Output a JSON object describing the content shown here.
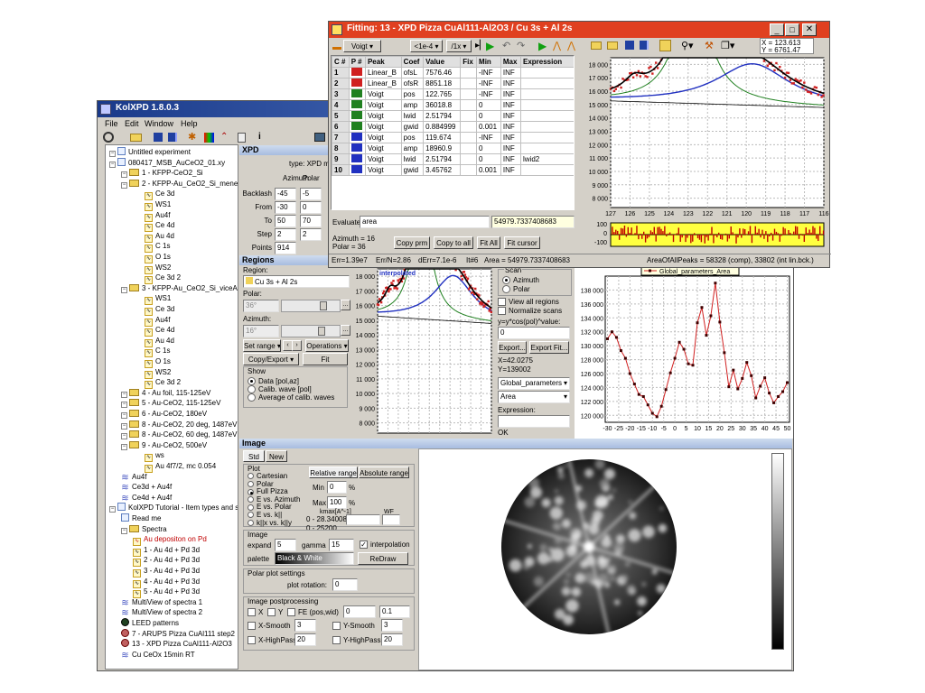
{
  "main_window": {
    "title": "KolXPD 1.8.0.3",
    "menu": [
      "File",
      "Edit",
      "Window",
      "Help"
    ],
    "tree": [
      {
        "label": "Untitled experiment",
        "depth": 0,
        "kind": "doc"
      },
      {
        "label": "080417_MSB_AuCeO2_01.xy",
        "depth": 0,
        "kind": "doc"
      },
      {
        "label": "1 - KFPP-CeO2_Si",
        "depth": 1,
        "kind": "folder"
      },
      {
        "label": "2 - KFPP-Au_CeO2_Si_meneAu",
        "depth": 1,
        "kind": "folder"
      },
      {
        "label": "Ce 3d",
        "depth": 3,
        "kind": "spec"
      },
      {
        "label": "WS1",
        "depth": 3,
        "kind": "spec"
      },
      {
        "label": "Au4f",
        "depth": 3,
        "kind": "spec"
      },
      {
        "label": "Ce 4d",
        "depth": 3,
        "kind": "spec"
      },
      {
        "label": "Au 4d",
        "depth": 3,
        "kind": "spec"
      },
      {
        "label": "C 1s",
        "depth": 3,
        "kind": "spec"
      },
      {
        "label": "O 1s",
        "depth": 3,
        "kind": "spec"
      },
      {
        "label": "WS2",
        "depth": 3,
        "kind": "spec"
      },
      {
        "label": "Ce 3d 2",
        "depth": 3,
        "kind": "spec"
      },
      {
        "label": "3 - KFPP-Au_CeO2_Si_viceAu",
        "depth": 1,
        "kind": "folder"
      },
      {
        "label": "WS1",
        "depth": 3,
        "kind": "spec"
      },
      {
        "label": "Ce 3d",
        "depth": 3,
        "kind": "spec"
      },
      {
        "label": "Au4f",
        "depth": 3,
        "kind": "spec"
      },
      {
        "label": "Ce 4d",
        "depth": 3,
        "kind": "spec"
      },
      {
        "label": "Au 4d",
        "depth": 3,
        "kind": "spec"
      },
      {
        "label": "C 1s",
        "depth": 3,
        "kind": "spec"
      },
      {
        "label": "O 1s",
        "depth": 3,
        "kind": "spec"
      },
      {
        "label": "WS2",
        "depth": 3,
        "kind": "spec"
      },
      {
        "label": "Ce 3d 2",
        "depth": 3,
        "kind": "spec"
      },
      {
        "label": "4 - Au foil, 115-125eV",
        "depth": 1,
        "kind": "folder"
      },
      {
        "label": "5 - Au-CeO2, 115-125eV",
        "depth": 1,
        "kind": "folder"
      },
      {
        "label": "6 - Au-CeO2, 180eV",
        "depth": 1,
        "kind": "folder"
      },
      {
        "label": "8 - Au-CeO2, 20 deg, 1487eV",
        "depth": 1,
        "kind": "folder"
      },
      {
        "label": "8 - Au-CeO2, 60 deg, 1487eV",
        "depth": 1,
        "kind": "folder"
      },
      {
        "label": "9 - Au-CeO2, 500eV",
        "depth": 1,
        "kind": "folder"
      },
      {
        "label": "ws",
        "depth": 3,
        "kind": "spec"
      },
      {
        "label": "Au 4f7/2, mc 0.054",
        "depth": 3,
        "kind": "spec"
      },
      {
        "label": "Au4f",
        "depth": 1,
        "kind": "multi"
      },
      {
        "label": "Ce3d + Au4f",
        "depth": 1,
        "kind": "multi"
      },
      {
        "label": "Ce4d + Au4f",
        "depth": 1,
        "kind": "multi"
      },
      {
        "label": "KolXPD Tutorial - Item types and sam",
        "depth": 0,
        "kind": "doc"
      },
      {
        "label": "Read me",
        "depth": 1,
        "kind": "doc"
      },
      {
        "label": "Spectra",
        "depth": 1,
        "kind": "folder"
      },
      {
        "label": "Au depositon on Pd",
        "depth": 2,
        "kind": "spec",
        "color": "#c00000"
      },
      {
        "label": "1 - Au 4d + Pd 3d",
        "depth": 2,
        "kind": "spec"
      },
      {
        "label": "2 - Au 4d + Pd 3d",
        "depth": 2,
        "kind": "spec"
      },
      {
        "label": "3 - Au 4d + Pd 3d",
        "depth": 2,
        "kind": "spec"
      },
      {
        "label": "4 - Au 4d + Pd 3d",
        "depth": 2,
        "kind": "spec"
      },
      {
        "label": "5 - Au 4d + Pd 3d",
        "depth": 2,
        "kind": "spec"
      },
      {
        "label": "MultiView of spectra 1",
        "depth": 1,
        "kind": "multi"
      },
      {
        "label": "MultiView of spectra 2",
        "depth": 1,
        "kind": "multi"
      },
      {
        "label": "LEED patterns",
        "depth": 1,
        "kind": "leed"
      },
      {
        "label": "7 - ARUPS Pizza CuAl111 step2",
        "depth": 1,
        "kind": "pizza"
      },
      {
        "label": "13 - XPD Pizza CuAl111-Al2O3",
        "depth": 1,
        "kind": "pizza"
      },
      {
        "label": "Cu CeOx 15min RT",
        "depth": 1,
        "kind": "multi"
      }
    ]
  },
  "xpd_panel": {
    "header": "XPD",
    "type_label": "type: XPD me",
    "col_azimuth": "Azimuth",
    "col_polar": "Polar",
    "rows": [
      {
        "label": "Backlash",
        "az": "-45",
        "pol": "-5"
      },
      {
        "label": "From",
        "az": "-30",
        "pol": "0"
      },
      {
        "label": "To",
        "az": "50",
        "pol": "70"
      },
      {
        "label": "Step",
        "az": "2",
        "pol": "2"
      },
      {
        "label": "Points",
        "az": "914",
        "pol": ""
      }
    ]
  },
  "regions_panel": {
    "header": "Regions",
    "region_label": "Region:",
    "region_value": "Cu 3s + Al 2s",
    "polar_label": "Polar:",
    "polar_value": "36°",
    "azimuth_label": "Azimuth:",
    "azimuth_value": "16°",
    "set_range": "Set range",
    "operations": "Operations",
    "copy_export": "Copy/Export",
    "fit": "Fit",
    "show_label": "Show",
    "show_options": [
      "Data [pol,az]",
      "Calib. wave [pol]",
      "Average of calib. waves"
    ],
    "plot_label": "interpolated",
    "scan_label": "Scan",
    "scan_options": [
      "Azimuth",
      "Polar"
    ],
    "view_all": "View all regions",
    "normalize": "Normalize scans",
    "formula_label": "y=y*cos(pol)^value:",
    "formula_value": "0",
    "export_btn": "Export...",
    "export_fit_btn": "Export Fit...",
    "x_readout": "X=42.0275",
    "y_readout": "Y=139002",
    "param_select": "Global_parameters",
    "area_select": "Area",
    "expression_label": "Expression:",
    "ok_label": "OK",
    "legend": "Global_parameters_Area"
  },
  "image_panel": {
    "header": "Image",
    "tabs": [
      "Std",
      "New"
    ],
    "plot_group": "Plot",
    "plot_options": [
      "Cartesian",
      "Polar",
      "Full Pizza",
      "E vs. Azimuth",
      "E vs. Polar",
      "E vs. k||",
      "k||x vs. k||y"
    ],
    "range_tabs": [
      "Relative range",
      "Absolute range"
    ],
    "min_label": "Min",
    "min_value": "0",
    "max_label": "Max",
    "max_value": "100",
    "pct": "%",
    "kmax_label": "kmax[A^-1]",
    "wf_label": "WF",
    "range1": "0 - 28.340081",
    "range2": "0 - 25200",
    "image_group": "Image",
    "expand_label": "expand",
    "expand_value": "5",
    "gamma_label": "gamma",
    "gamma_value": "15",
    "interp_label": "interpolation",
    "palette_label": "palette",
    "palette_value": "Black & White",
    "redraw": "ReDraw",
    "polar_settings": "Polar plot settings",
    "rotation_label": "plot rotation:",
    "rotation_value": "0",
    "postproc": "Image postprocessing",
    "x_lbl": "X",
    "y_lbl": "Y",
    "fe_lbl": "FE (pos,wid)",
    "fe_pos": "0",
    "fe_wid": "0.1",
    "xsmooth": "X-Smooth",
    "xsmooth_v": "3",
    "ysmooth": "Y-Smooth",
    "ysmooth_v": "3",
    "xhigh": "X-HighPass",
    "xhigh_v": "20",
    "yhigh": "Y-HighPass",
    "yhigh_v": "20"
  },
  "fit_window": {
    "title": "Fitting: 13 - XPD Pizza CuAl111-Al2O3 / Cu 3s + Al 2s",
    "profile": "Voigt",
    "tol": "<1e-4",
    "iter": "/1x",
    "coords": [
      "X = 123.613",
      "Y = 6761.47"
    ],
    "headers": [
      "C #",
      "P #",
      "Peak",
      "Coef",
      "Value",
      "Fix",
      "Min",
      "Max",
      "Expression"
    ],
    "rows": [
      {
        "c": "1",
        "color": "#d02020",
        "peak": "Linear_B",
        "coef": "ofsL",
        "value": "7576.46",
        "fix": "",
        "min": "-INF",
        "max": "INF",
        "expr": ""
      },
      {
        "c": "2",
        "color": "#d02020",
        "peak": "Linear_B",
        "coef": "ofsR",
        "value": "8851.18",
        "fix": "",
        "min": "-INF",
        "max": "INF",
        "expr": ""
      },
      {
        "c": "3",
        "color": "#208020",
        "peak": "Voigt",
        "coef": "pos",
        "value": "122.765",
        "fix": "",
        "min": "-INF",
        "max": "INF",
        "expr": ""
      },
      {
        "c": "4",
        "color": "#208020",
        "peak": "Voigt",
        "coef": "amp",
        "value": "36018.8",
        "fix": "",
        "min": "0",
        "max": "INF",
        "expr": ""
      },
      {
        "c": "5",
        "color": "#208020",
        "peak": "Voigt",
        "coef": "lwid",
        "value": "2.51794",
        "fix": "",
        "min": "0",
        "max": "INF",
        "expr": ""
      },
      {
        "c": "6",
        "color": "#208020",
        "peak": "Voigt",
        "coef": "gwid",
        "value": "0.884999",
        "fix": "",
        "min": "0.001",
        "max": "INF",
        "expr": ""
      },
      {
        "c": "7",
        "color": "#2030c0",
        "peak": "Voigt",
        "coef": "pos",
        "value": "119.674",
        "fix": "",
        "min": "-INF",
        "max": "INF",
        "expr": ""
      },
      {
        "c": "8",
        "color": "#2030c0",
        "peak": "Voigt",
        "coef": "amp",
        "value": "18960.9",
        "fix": "",
        "min": "0",
        "max": "INF",
        "expr": ""
      },
      {
        "c": "9",
        "color": "#2030c0",
        "peak": "Voigt",
        "coef": "lwid",
        "value": "2.51794",
        "fix": "",
        "min": "0",
        "max": "INF",
        "expr": "lwid2"
      },
      {
        "c": "10",
        "color": "#2030c0",
        "peak": "Voigt",
        "coef": "gwid",
        "value": "3.45762",
        "fix": "",
        "min": "0.001",
        "max": "INF",
        "expr": ""
      }
    ],
    "evaluate_label": "Evaluate:",
    "evaluate_value": "area",
    "evaluate_result": "54979.7337408683",
    "az_info": "Azimuth = 16",
    "pol_info": "Polar = 36",
    "copy_prm": "Copy prm",
    "copy_all": "Copy to all",
    "fit_all": "Fit All",
    "fit_cursor": "Fit cursor",
    "status": [
      "Err=1.39e7",
      "Err/N=2.86",
      "dErr=7.1e-6",
      "It#6",
      "Area = 54979.7337408683",
      "AreaOfAllPeaks = 58328 (comp), 33802 (int lin.bck.)"
    ]
  },
  "chart_data": [
    {
      "type": "line",
      "title": "",
      "x_ticks": [
        "127",
        "126",
        "125",
        "124",
        "123",
        "122",
        "121",
        "120",
        "119",
        "118",
        "117",
        "116"
      ],
      "y_ticks": [
        "8 000",
        "9 000",
        "10 000",
        "11 000",
        "12 000",
        "13 000",
        "14 000",
        "15 000",
        "16 000",
        "17 000",
        "18 000"
      ],
      "xlim": [
        127,
        116
      ],
      "ylim": [
        7300,
        18500
      ],
      "series": [
        {
          "name": "",
          "color": "#000000",
          "kind": "fit",
          "comp": "total"
        },
        {
          "name": "",
          "color": "#208020",
          "kind": "fit",
          "comp": "p1"
        },
        {
          "name": "",
          "color": "#2030c0",
          "kind": "fit",
          "comp": "p2"
        },
        {
          "name": "",
          "color": "#000000",
          "kind": "fit",
          "comp": "bg"
        }
      ],
      "points_color": "#d02020",
      "residual_ticks": [
        "100",
        "0",
        "-100"
      ]
    },
    {
      "type": "line",
      "title": "interpolated",
      "x_ticks": [],
      "y_ticks": [
        "8 000",
        "9 000",
        "10 000",
        "11 000",
        "12 000",
        "13 000",
        "14 000",
        "15 000",
        "16 000",
        "17 000",
        "18 000"
      ],
      "ylim": [
        7300,
        18500
      ]
    },
    {
      "type": "line",
      "title": "Global_parameters_Area",
      "x": [
        -30,
        -28,
        -26,
        -24,
        -22,
        -20,
        -18,
        -16,
        -14,
        -12,
        -10,
        -8,
        -6,
        -4,
        -2,
        0,
        2,
        4,
        6,
        8,
        10,
        12,
        14,
        16,
        18,
        20,
        22,
        24,
        26,
        28,
        30,
        32,
        34,
        36,
        38,
        40,
        42,
        44,
        46,
        48,
        50
      ],
      "values": [
        131000,
        132000,
        131200,
        129300,
        128200,
        126000,
        124500,
        123000,
        122700,
        121500,
        120300,
        119800,
        121300,
        123700,
        126100,
        128200,
        130500,
        129500,
        127400,
        127200,
        133300,
        135500,
        131500,
        134300,
        139000,
        133400,
        129000,
        124100,
        126500,
        123800,
        125300,
        127600,
        125700,
        122500,
        124200,
        125400,
        123200,
        121800,
        122700,
        123400,
        124700
      ],
      "x_ticks": [
        "-30",
        "-25",
        "-20",
        "-15",
        "-10",
        "-5",
        "0",
        "5",
        "10",
        "15",
        "20",
        "25",
        "30",
        "35",
        "40",
        "45",
        "50"
      ],
      "y_ticks": [
        "120 000",
        "122 000",
        "124 000",
        "126 000",
        "128 000",
        "130 000",
        "132 000",
        "134 000",
        "136 000",
        "138 000"
      ],
      "xlim": [
        -31,
        51
      ],
      "ylim": [
        119000,
        140000
      ],
      "color": "#d02020",
      "legend_position": "top"
    }
  ]
}
